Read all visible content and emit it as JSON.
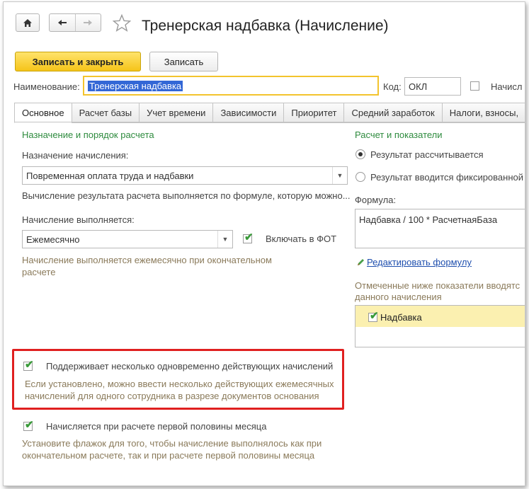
{
  "window": {
    "title": "Тренерская надбавка (Начисление)",
    "nav": {
      "home_icon": "home-icon",
      "back_icon": "arrow-left-icon",
      "forward_icon": "arrow-right-icon",
      "star_icon": "star-icon"
    }
  },
  "toolbar": {
    "save_close_label": "Записать и закрыть",
    "save_label": "Записать"
  },
  "header": {
    "name_label": "Наименование:",
    "name_value": "Тренерская надбавка",
    "code_label": "Код:",
    "code_value": "ОКЛ",
    "accrual_cut": "Начисл"
  },
  "tabs": [
    {
      "label": "Основное"
    },
    {
      "label": "Расчет базы"
    },
    {
      "label": "Учет времени"
    },
    {
      "label": "Зависимости"
    },
    {
      "label": "Приоритет"
    },
    {
      "label": "Средний заработок"
    },
    {
      "label": "Налоги, взносы,"
    }
  ],
  "left": {
    "section_title": "Назначение и порядок расчета",
    "purpose_label": "Назначение начисления:",
    "purpose_value": "Повременная оплата труда и надбавки",
    "formula_note": "Вычисление результата расчета выполняется по формуле, которую можно...",
    "period_label": "Начисление выполняется:",
    "period_value": "Ежемесячно",
    "fot_label": "Включать в ФОТ",
    "period_hint_1": "Начисление выполняется ежемесячно при окончательном",
    "period_hint_2": "расчете",
    "multi_label": "Поддерживает несколько одновременно действующих начислений",
    "multi_hint_1": "Если установлено, можно ввести несколько действующих ежемесячных",
    "multi_hint_2": "начислений для одного сотрудника в разрезе документов основания",
    "half_label": "Начисляется при расчете первой половины месяца",
    "half_hint_1": "Установите флажок для того, чтобы начисление выполнялось как при",
    "half_hint_2": "окончательном расчете, так и при расчете первой половины месяца"
  },
  "right": {
    "section_title": "Расчет и показатели",
    "radio_calc": "Результат рассчитывается",
    "radio_fixed": "Результат вводится фиксированной",
    "formula_label": "Формула:",
    "formula_value": "Надбавка / 100 * РасчетнаяБаза",
    "edit_formula_link": "Редактировать формулу",
    "indicators_note_1": "Отмеченные ниже показатели вводятс",
    "indicators_note_2": "данного начисления",
    "indicator_item": "Надбавка"
  },
  "colors": {
    "primary_button": "#f5c419",
    "section_green": "#2e8b3e",
    "hint_brown": "#8a7a5a",
    "highlight_red": "#e02020",
    "indicator_row": "#fbf0b0"
  }
}
